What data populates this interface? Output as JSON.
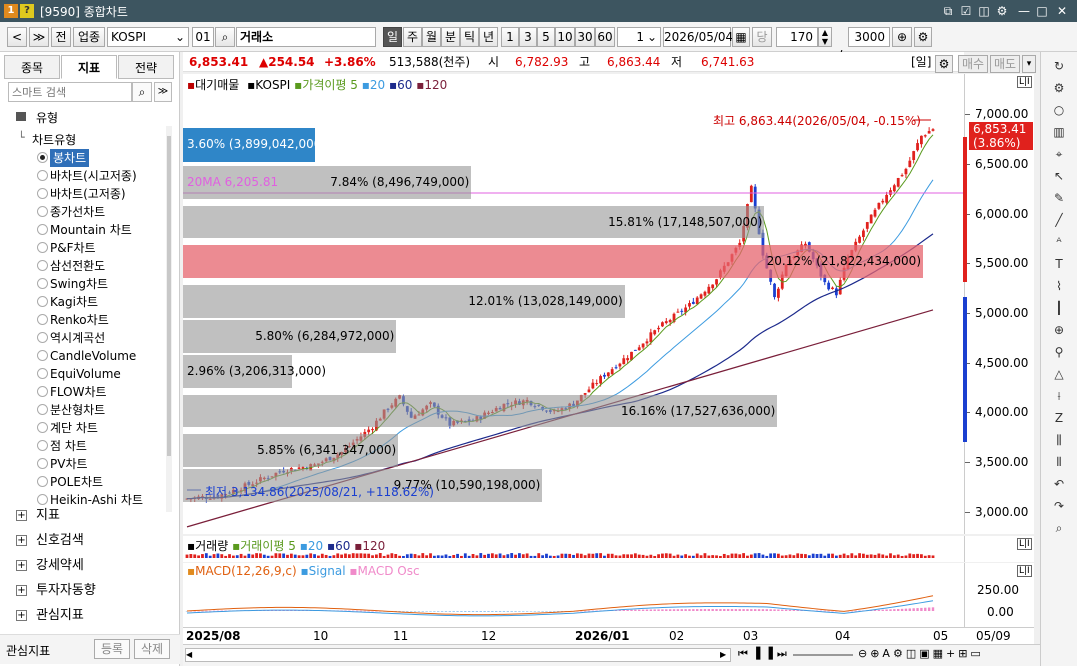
{
  "window": {
    "title": "[9590] 종합차트",
    "badge1": "1",
    "badge2": "?"
  },
  "toolbar": {
    "nav_prev": "<",
    "nav_menu": "≫",
    "jeon": "전",
    "upjong": "업종",
    "symbol": "KOSPI",
    "code": "01",
    "market": "거래소",
    "periods": [
      "일",
      "주",
      "월",
      "분",
      "틱",
      "년"
    ],
    "nums": [
      "1",
      "3",
      "5",
      "10",
      "30",
      "60"
    ],
    "count_field": "1",
    "date": "2026/05/04",
    "dang": "당",
    "bars": "170",
    "slash": "/",
    "total": "3000"
  },
  "left": {
    "tabs": [
      "종목",
      "지표",
      "전략"
    ],
    "search_placeholder": "스마트 검색",
    "section_type": "유형",
    "chart_types_header": "차트유형",
    "items": [
      "봉차트",
      "바차트(시고저종)",
      "바차트(고저종)",
      "종가선차트",
      "Mountain 차트",
      "P&F차트",
      "삼선전환도",
      "Swing차트",
      "Kagi차트",
      "Renko차트",
      "역시계곡선",
      "CandleVolume",
      "EquiVolume",
      "FLOW차트",
      "분산형차트",
      "계단 차트",
      "점 차트",
      "PV차트",
      "POLE차트",
      "Heikin-Ashi 차트"
    ],
    "sections": [
      "지표",
      "신호검색",
      "강세약세",
      "투자자동향",
      "관심지표"
    ],
    "footer_label": "관심지표",
    "btn_reg": "등록",
    "btn_del": "삭제"
  },
  "info": {
    "price": "6,853.41",
    "change": "▲254.54",
    "pct": "+3.86%",
    "volume": "513,588(천주)",
    "open_label": "시",
    "open": "6,782.93",
    "high_label": "고",
    "high": "6,863.44",
    "low_label": "저",
    "low": "6,741.63",
    "period_tag": "[일]",
    "buy": "매수",
    "sell": "매도"
  },
  "legend": {
    "l1": "대기매물",
    "l2": "KOSPI",
    "l3": "가격이평 5",
    "l4": "20",
    "l5": "60",
    "l6": "120"
  },
  "annot": {
    "high": "최고 6,863.44(2026/05/04, -0.15%)",
    "low": "최저 3,134.86(2025/08/21, +118.62%)",
    "ma20": "20MA 6,205.81",
    "price_tag": "6,853.41",
    "pct_tag": "(3.86%)"
  },
  "vp": [
    {
      "label": "3.60% (3,899,042,000)",
      "pct": 3.6
    },
    {
      "label": "7.84% (8,496,749,000)",
      "pct": 7.84
    },
    {
      "label": "15.81% (17,148,507,000)",
      "pct": 15.81
    },
    {
      "label": "20.12% (21,822,434,000)",
      "pct": 20.12
    },
    {
      "label": "12.01% (13,028,149,000)",
      "pct": 12.01
    },
    {
      "label": "5.80% (6,284,972,000)",
      "pct": 5.8
    },
    {
      "label": "2.96% (3,206,313,000)",
      "pct": 2.96
    },
    {
      "label": "16.16% (17,527,636,000)",
      "pct": 16.16
    },
    {
      "label": "5.85% (6,341,347,000)",
      "pct": 5.85
    },
    {
      "label": "9.77% (10,590,198,000)",
      "pct": 9.77
    }
  ],
  "yaxis": [
    "7,000.00",
    "6,500.00",
    "6,000.00",
    "5,500.00",
    "5,000.00",
    "4,500.00",
    "4,000.00",
    "3,500.00",
    "3,000.00"
  ],
  "vol_legend": {
    "l1": "거래량",
    "l2": "거래이평 5",
    "l3": "20",
    "l4": "60",
    "l5": "120"
  },
  "macd_legend": {
    "l1": "MACD(12,26,9,c)",
    "l2": "Signal",
    "l3": "MACD Osc"
  },
  "macd_y": [
    "250.00",
    "0.00"
  ],
  "xaxis": [
    "2025/08",
    "10",
    "11",
    "12",
    "2026/01",
    "02",
    "03",
    "04",
    "05",
    "05/09"
  ],
  "lli": "L|I",
  "colors": {
    "up": "#e0211d",
    "down": "#1a3fd0",
    "ma5": "#5a9a1e",
    "ma20": "#3c9be0",
    "ma60": "#1c2a8c",
    "ma120": "#7a1f3a"
  }
}
